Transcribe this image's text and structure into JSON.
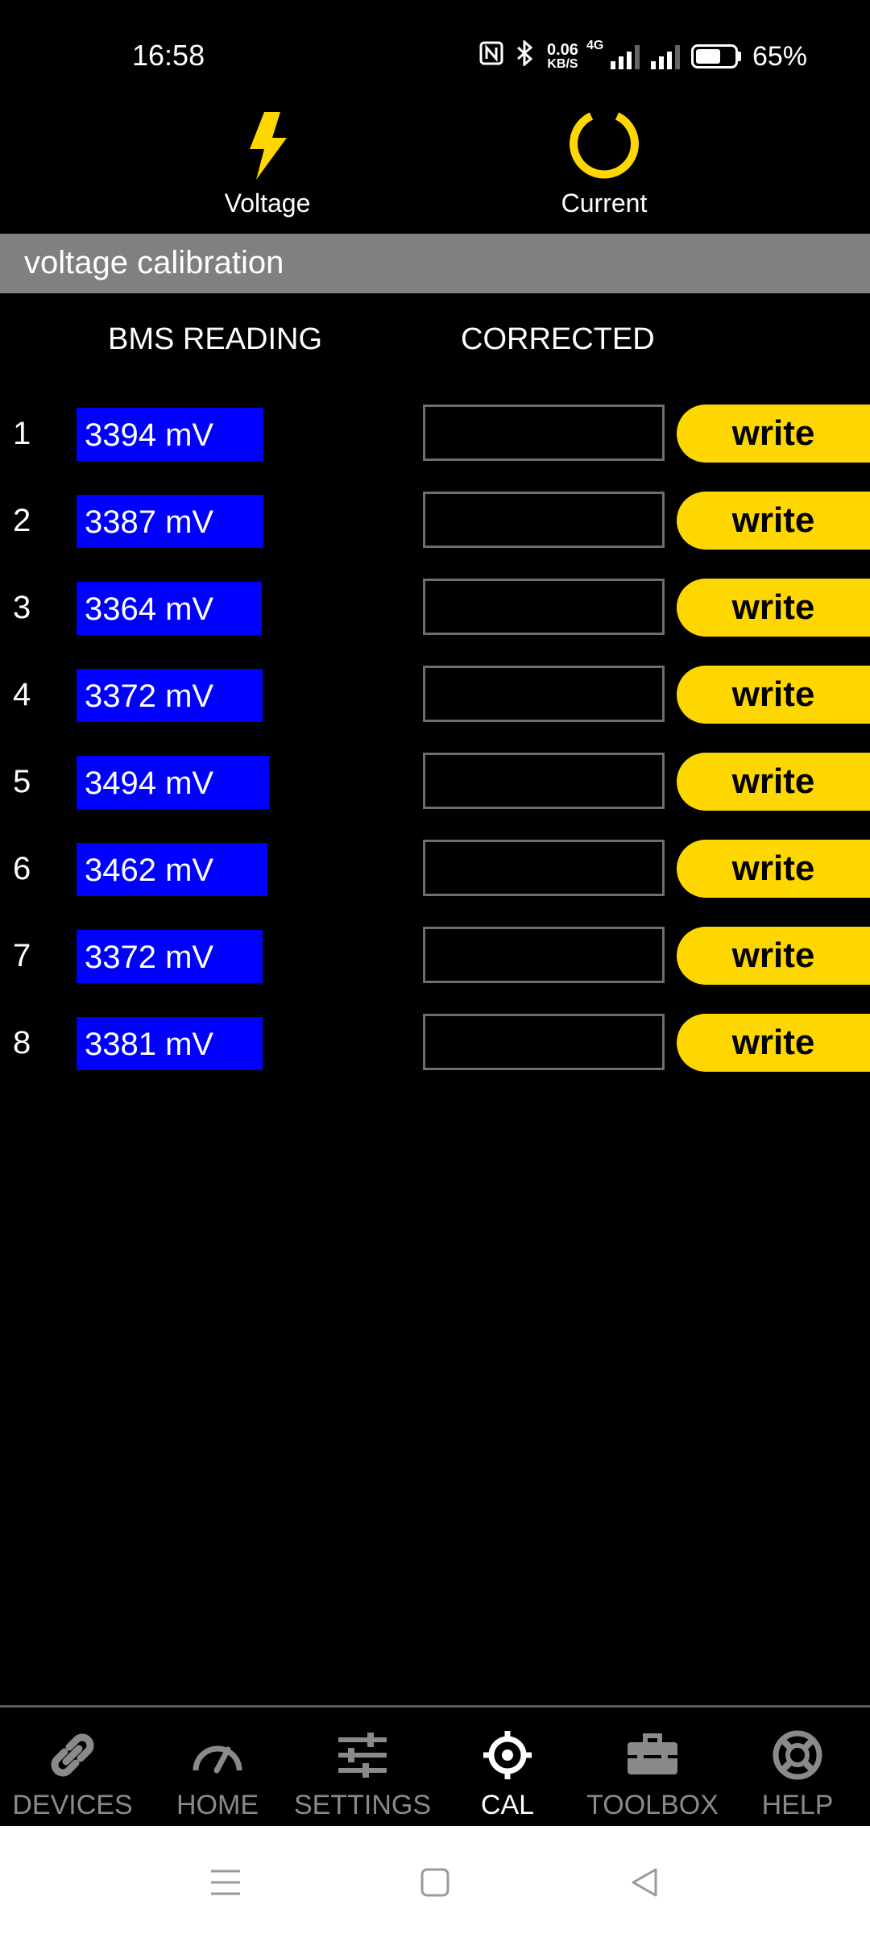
{
  "status_bar": {
    "time": "16:58",
    "net_speed_value": "0.06",
    "net_speed_unit": "KB/S",
    "network_type": "4G",
    "battery_percent": "65%",
    "battery_level": 0.65
  },
  "mode_tabs": [
    {
      "label": "Voltage",
      "icon": "lightning-bolt-icon"
    },
    {
      "label": "Current",
      "icon": "ring-icon"
    }
  ],
  "section": {
    "title": "voltage calibration"
  },
  "columns": {
    "bms": "BMS READING",
    "corrected": "CORRECTED"
  },
  "rows": [
    {
      "num": "1",
      "reading": "3394 mV",
      "mv": 3394,
      "corrected": "",
      "button": "write"
    },
    {
      "num": "2",
      "reading": "3387 mV",
      "mv": 3387,
      "corrected": "",
      "button": "write"
    },
    {
      "num": "3",
      "reading": "3364 mV",
      "mv": 3364,
      "corrected": "",
      "button": "write"
    },
    {
      "num": "4",
      "reading": "3372 mV",
      "mv": 3372,
      "corrected": "",
      "button": "write"
    },
    {
      "num": "5",
      "reading": "3494 mV",
      "mv": 3494,
      "corrected": "",
      "button": "write"
    },
    {
      "num": "6",
      "reading": "3462 mV",
      "mv": 3462,
      "corrected": "",
      "button": "write"
    },
    {
      "num": "7",
      "reading": "3372 mV",
      "mv": 3372,
      "corrected": "",
      "button": "write"
    },
    {
      "num": "8",
      "reading": "3381 mV",
      "mv": 3381,
      "corrected": "",
      "button": "write"
    }
  ],
  "bottom_nav": [
    {
      "label": "DEVICES",
      "icon": "link-icon",
      "active": false
    },
    {
      "label": "HOME",
      "icon": "gauge-icon",
      "active": false
    },
    {
      "label": "SETTINGS",
      "icon": "sliders-icon",
      "active": false
    },
    {
      "label": "CAL",
      "icon": "crosshair-icon",
      "active": true
    },
    {
      "label": "TOOLBOX",
      "icon": "toolbox-icon",
      "active": false
    },
    {
      "label": "HELP",
      "icon": "lifebuoy-icon",
      "active": false
    }
  ],
  "colors": {
    "accent_yellow": "#ffd700",
    "reading_blue": "#0000ff",
    "header_gray": "#808080",
    "inactive_nav": "#8a8a8a"
  }
}
